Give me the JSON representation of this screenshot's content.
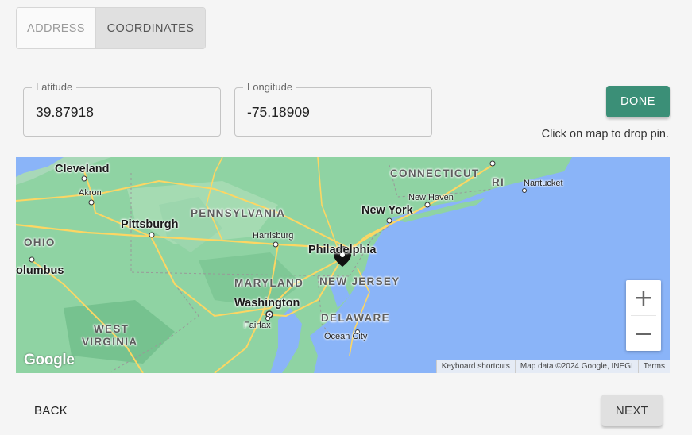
{
  "mode_toggle": {
    "address_label": "ADDRESS",
    "coordinates_label": "COORDINATES",
    "selected": "COORDINATES"
  },
  "latitude": {
    "label": "Latitude",
    "value": "39.87918"
  },
  "longitude": {
    "label": "Longitude",
    "value": "-75.18909"
  },
  "done_label": "DONE",
  "hint": "Click on map to drop pin.",
  "map": {
    "state_labels": [
      "PENNSYLVANIA",
      "CONNECTICUT",
      "RI",
      "OHIO",
      "MARYLAND",
      "NEW JERSEY",
      "DELAWARE",
      "WEST",
      "VIRGINIA"
    ],
    "major_cities": [
      "Cleveland",
      "Pittsburgh",
      "New York",
      "Philadelphia",
      "Washington",
      "olumbus"
    ],
    "minor_cities": [
      "Akron",
      "Harrisburg",
      "New Haven",
      "Nantucket",
      "Fairfax",
      "Ocean City"
    ],
    "zoom_in": "+",
    "zoom_out": "−",
    "google_logo": "Google",
    "attribution": {
      "shortcuts": "Keyboard shortcuts",
      "data": "Map data ©2024 Google, INEGI",
      "terms": "Terms"
    },
    "colors": {
      "water": "#8ab4f8",
      "land": "#8fd3a3",
      "roads": "#fdd663"
    }
  },
  "nav": {
    "back_label": "BACK",
    "next_label": "NEXT"
  }
}
